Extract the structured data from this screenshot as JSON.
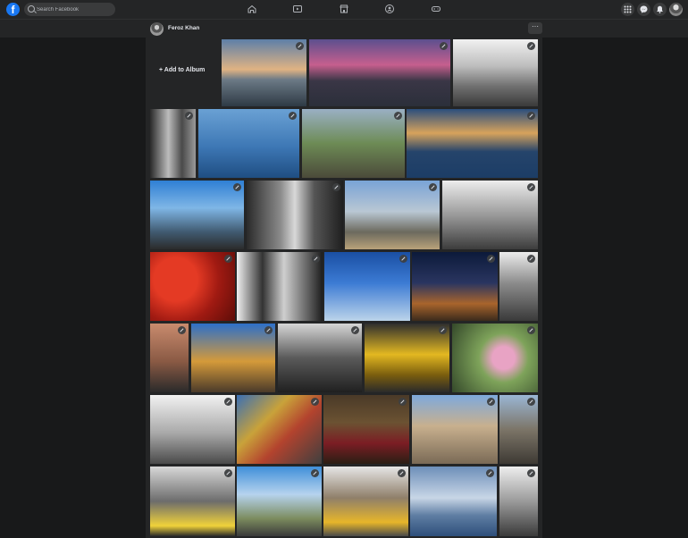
{
  "topbar": {
    "logo": "f",
    "search_placeholder": "Search Facebook",
    "nav_icons": [
      "home-icon",
      "watch-icon",
      "marketplace-icon",
      "groups-icon",
      "gaming-icon"
    ],
    "right_icons": [
      "menu-grid-icon",
      "messenger-icon",
      "notifications-icon"
    ]
  },
  "profile": {
    "name": "Feroz Khan",
    "more_label": "···"
  },
  "album": {
    "add_label": "+ Add to Album"
  },
  "photos": [
    {
      "g": "linear-gradient(180deg,#5d7fa8 0%,#e0b383 45%,#6c7a86 60%,#2e3a45 100%)"
    },
    {
      "g": "linear-gradient(180deg,#5c4f8e 0%,#c65f8e 38%,#3a3646 62%,#2b2f3a 100%)"
    },
    {
      "g": "linear-gradient(180deg,#f1f1f1 0%,#bdbdbd 40%,#707070 70%,#3a3a3a 100%)"
    },
    {
      "g": "linear-gradient(90deg,#2a2a2a 0%,#bcbcbc 40%,#4a4a4a 70%,#9a9a9a 100%)"
    },
    {
      "g": "linear-gradient(180deg,#6aa1d4 0%,#3d77b5 55%,#1f4e82 100%)"
    },
    {
      "g": "linear-gradient(180deg,#9ab0c4 0%,#6d8b55 50%,#4b4a3a 100%)"
    },
    {
      "g": "linear-gradient(180deg,#2b4e7d 0%,#d7a35c 35%,#25446b 62%,#1c3d66 100%)"
    },
    {
      "g": "linear-gradient(180deg,#2f7fd4 0%,#7fb6e6 40%,#405a70 75%,#2b2b2b 100%)"
    },
    {
      "g": "linear-gradient(90deg,#2a2a2a 0%,#8a8a8a 35%,#d8d8d8 50%,#555 70%,#1f1f1f 100%)"
    },
    {
      "g": "linear-gradient(180deg,#79a3d6 0%,#b9c7d4 45%,#6c6a5e 75%,#b9a27a 100%)"
    },
    {
      "g": "linear-gradient(180deg,#ededed 0%,#9a9a9a 50%,#3c3c3c 100%)"
    },
    {
      "g": "radial-gradient(circle at 30% 40%,#e43a24 0 30%,#a01a12 60%,#5e0d08 100%)"
    },
    {
      "g": "linear-gradient(90deg,#f0f0f0 0%,#333 30%,#cfcfcf 55%,#1e1e1e 100%)"
    },
    {
      "g": "linear-gradient(180deg,#1a4fa3 0%,#3c7bd4 45%,#bcd4ea 100%)"
    },
    {
      "g": "linear-gradient(180deg,#0c1a3a 0%,#2a3560 45%,#a8642c 75%,#3b2a1c 100%)"
    },
    {
      "g": "linear-gradient(180deg,#ececec 0%,#8c8c8c 45%,#3a3a3a 100%)"
    },
    {
      "g": "linear-gradient(180deg,#c98b6e 0%,#8a5a44 55%,#2a2a2a 100%)"
    },
    {
      "g": "linear-gradient(180deg,#2d6fc9 0%,#d49a3a 55%,#4a3a2a 100%)"
    },
    {
      "g": "linear-gradient(180deg,#d6d6d6 0%,#5a5a5a 50%,#202020 100%)"
    },
    {
      "g": "linear-gradient(180deg,#2e2e2e 0%,#e3b821 45%,#7a5d0e 75%,#2a2a2a 100%)"
    },
    {
      "g": "radial-gradient(circle at 60% 50%,#e8a3c4 0 18%,#7ea35a 40%,#34482a 100%)"
    },
    {
      "g": "linear-gradient(180deg,#f2f2f2 0%,#a9a9a9 55%,#4a4a4a 100%)"
    },
    {
      "g": "linear-gradient(135deg,#3a6fb4 0%,#c9a23a 35%,#b3432e 60%,#3f3f3f 100%)"
    },
    {
      "g": "linear-gradient(180deg,#4a3a28 0%,#6b5232 40%,#7b1d24 70%,#2a1e14 100%)"
    },
    {
      "g": "linear-gradient(180deg,#7ea9dc 0%,#c8b08e 45%,#7a6a56 100%)"
    },
    {
      "g": "linear-gradient(180deg,#9ab6d4 0%,#7c7568 50%,#3e3a34 100%)"
    },
    {
      "g": "linear-gradient(180deg,#d8d8d8 0%,#6c6c6c 50%,#f0d23a 85%,#2a2a2a 100%)"
    },
    {
      "g": "linear-gradient(180deg,#3f8fd9 0%,#b6d3ee 40%,#7b8b5e 75%,#3a3a3a 100%)"
    },
    {
      "g": "linear-gradient(180deg,#e6e6e6 0%,#8f7f6a 45%,#e7b62a 80%,#4a4a4a 100%)"
    },
    {
      "g": "linear-gradient(180deg,#6d8fb9 0%,#c8d6e6 45%,#5f7ea3 70%,#2e4f7b 100%)"
    },
    {
      "g": "linear-gradient(180deg,#eeeeee 0%,#9a9a9a 50%,#3a3a3a 100%)"
    }
  ]
}
